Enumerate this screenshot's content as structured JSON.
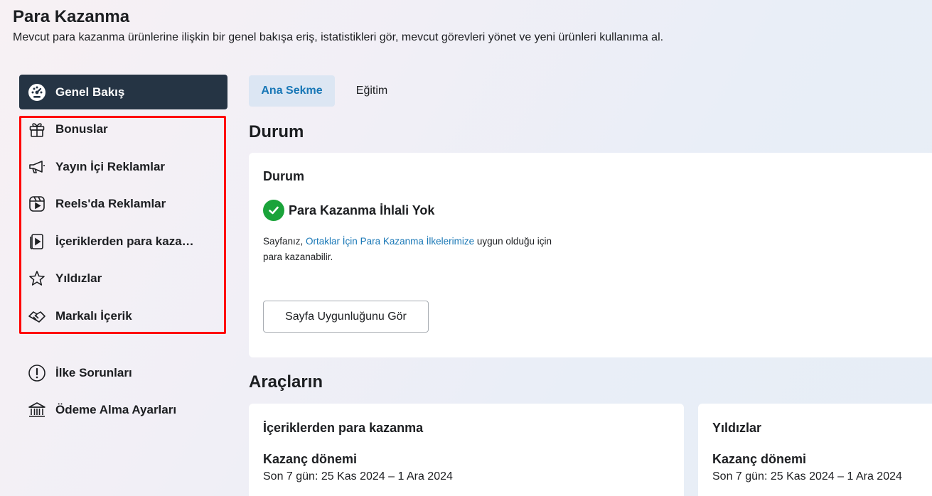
{
  "header": {
    "title": "Para Kazanma",
    "subtitle": "Mevcut para kazanma ürünlerine ilişkin bir genel bakışa eriş, istatistikleri gör, mevcut görevleri yönet ve yeni ürünleri kullanıma al."
  },
  "sidebar": {
    "active": {
      "label": "Genel Bakış",
      "icon": "dashboard-icon"
    },
    "group_items": [
      {
        "label": "Bonuslar",
        "icon": "gift-icon"
      },
      {
        "label": "Yayın İçi Reklamlar",
        "icon": "megaphone-icon"
      },
      {
        "label": "Reels'da Reklamlar",
        "icon": "reels-icon"
      },
      {
        "label": "İçeriklerden para kaza…",
        "icon": "content-video-icon"
      },
      {
        "label": "Yıldızlar",
        "icon": "star-icon"
      },
      {
        "label": "Markalı İçerik",
        "icon": "handshake-icon"
      }
    ],
    "other_items": [
      {
        "label": "İlke Sorunları",
        "icon": "alert-icon"
      },
      {
        "label": "Ödeme Alma Ayarları",
        "icon": "bank-icon"
      }
    ]
  },
  "tabs": [
    {
      "label": "Ana Sekme",
      "active": true
    },
    {
      "label": "Eğitim",
      "active": false
    }
  ],
  "status": {
    "heading": "Durum",
    "card_title": "Durum",
    "status_text": "Para Kazanma İhlali Yok",
    "desc_prefix": "Sayfanız, ",
    "desc_link": "Ortaklar İçin Para Kazanma İlkelerimize",
    "desc_suffix": " uygun olduğu için para kazanabilir.",
    "button_label": "Sayfa Uygunluğunu Gör"
  },
  "tools": {
    "heading": "Araçların",
    "cards": [
      {
        "title": "İçeriklerden para kazanma",
        "sub": "Kazanç dönemi",
        "date": "Son 7 gün: 25 Kas 2024 – 1 Ara 2024"
      },
      {
        "title": "Yıldızlar",
        "sub": "Kazanç dönemi",
        "date": "Son 7 gün: 25 Kas 2024 – 1 Ara 2024"
      }
    ]
  },
  "colors": {
    "accent": "#1877b6",
    "active_nav": "#253444",
    "highlight": "#ff0000",
    "success": "#1aa33a"
  }
}
